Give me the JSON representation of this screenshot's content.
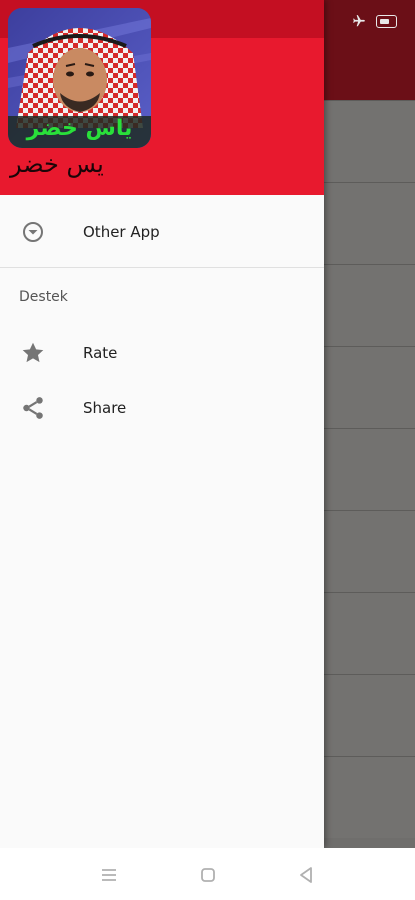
{
  "drawer": {
    "app_title": "يس خضر",
    "avatar_caption": "ياس خضر",
    "items": [
      {
        "label": "Other App",
        "icon": "dropdown-circle-icon"
      },
      {
        "label": "Rate",
        "icon": "star-icon"
      },
      {
        "label": "Share",
        "icon": "share-icon"
      }
    ],
    "section_header": "Destek"
  },
  "status_bar": {
    "icons": [
      "airplane-icon",
      "battery-icon"
    ]
  },
  "navigation_bar": {
    "buttons": [
      "menu-icon",
      "home-icon",
      "back-icon"
    ]
  },
  "colors": {
    "header_red": "#e8192e",
    "toolbar_dark": "#6b0f17",
    "caption_green": "#29e03a"
  }
}
